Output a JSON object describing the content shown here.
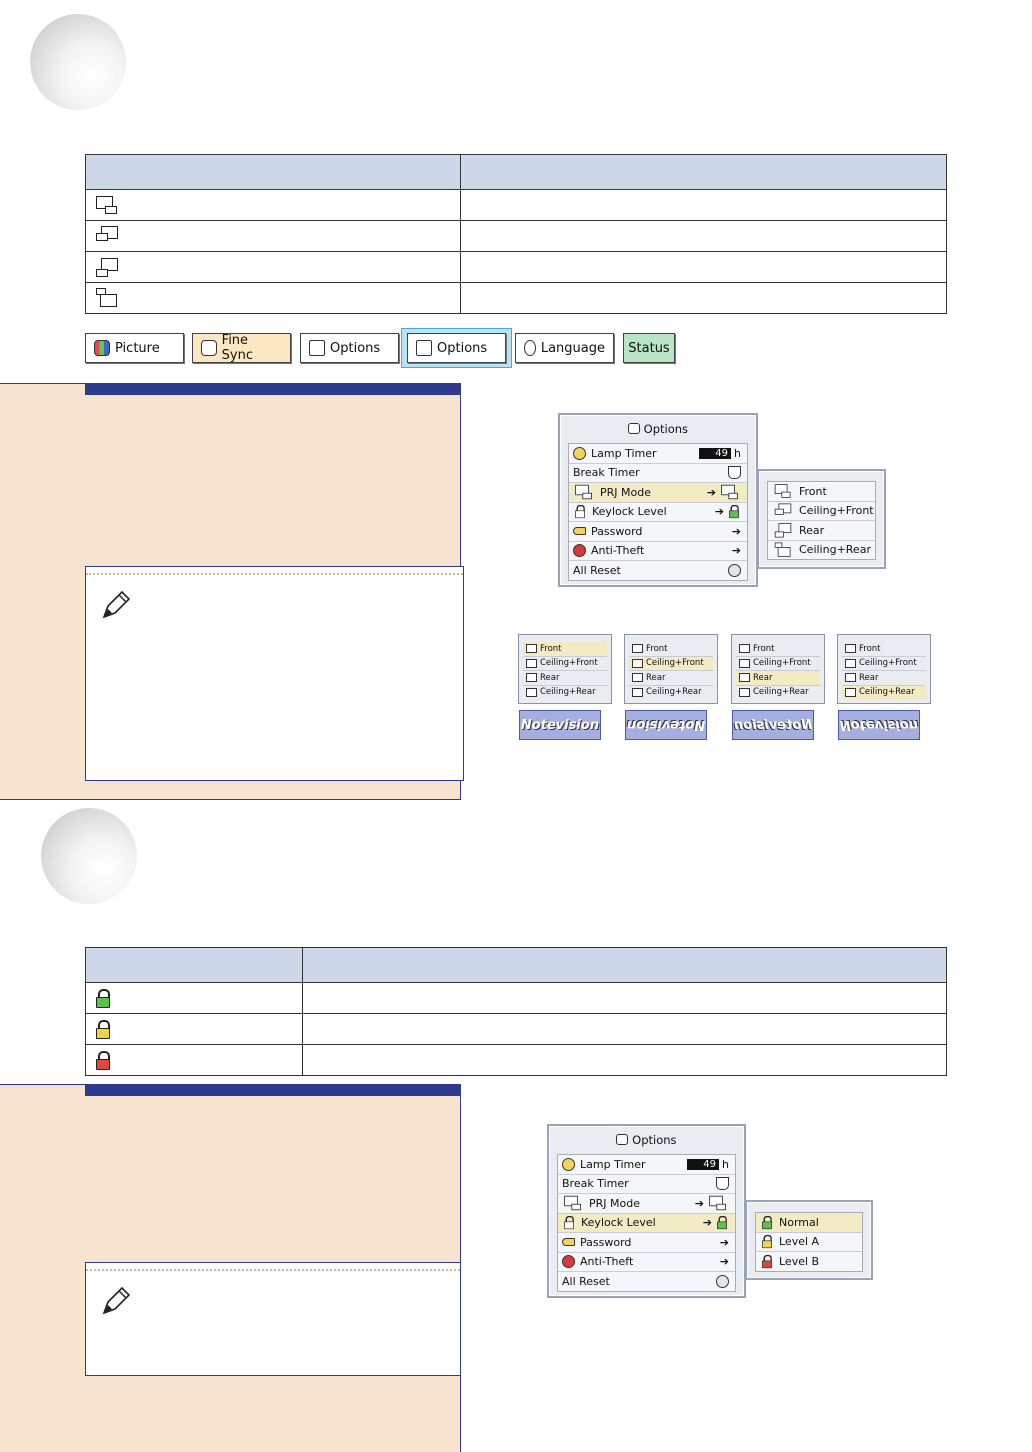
{
  "tabs": [
    {
      "label": "Picture",
      "bg": "#ffffff"
    },
    {
      "label": "Fine Sync",
      "bg": "#fbe8c2"
    },
    {
      "label": "Options",
      "bg": "#ffffff"
    },
    {
      "label": "Options",
      "bg": "#ffffff"
    },
    {
      "label": "Language",
      "bg": "#ffffff"
    },
    {
      "label": "Status",
      "bg": "#b9e4c6"
    }
  ],
  "prj_menu": {
    "title": "Options",
    "rows": [
      {
        "label": "Lamp Timer",
        "value": "49",
        "unit": "h"
      },
      {
        "label": "Break Timer"
      },
      {
        "label": "PRJ Mode"
      },
      {
        "label": "Keylock Level"
      },
      {
        "label": "Password"
      },
      {
        "label": "Anti-Theft"
      },
      {
        "label": "All Reset"
      }
    ],
    "submenu": [
      "Front",
      "Ceiling+Front",
      "Rear",
      "Ceiling+Rear"
    ]
  },
  "thumbs": [
    {
      "items": [
        "Front",
        "Ceiling+Front",
        "Rear",
        "Ceiling+Rear"
      ],
      "logo": "Notevision"
    },
    {
      "items": [
        "Front",
        "Ceiling+Front",
        "Rear",
        "Ceiling+Rear"
      ],
      "logo": "Notevision"
    },
    {
      "items": [
        "Front",
        "Ceiling+Front",
        "Rear",
        "Ceiling+Rear"
      ],
      "logo": "Notevision"
    },
    {
      "items": [
        "Front",
        "Ceiling+Front",
        "Rear",
        "Ceiling+Rear"
      ],
      "logo": "Notevision"
    }
  ],
  "key_menu": {
    "title": "Options",
    "rows": [
      {
        "label": "Lamp Timer",
        "value": "49",
        "unit": "h"
      },
      {
        "label": "Break Timer"
      },
      {
        "label": "PRJ Mode"
      },
      {
        "label": "Keylock Level"
      },
      {
        "label": "Password"
      },
      {
        "label": "Anti-Theft"
      },
      {
        "label": "All Reset"
      }
    ],
    "submenu": [
      "Normal",
      "Level A",
      "Level B"
    ]
  },
  "colors": {
    "accent": "#2e3a8c",
    "panel": "#f6e4d0",
    "table_header": "#cdd9e8",
    "highlight": "#f3ebc4"
  }
}
